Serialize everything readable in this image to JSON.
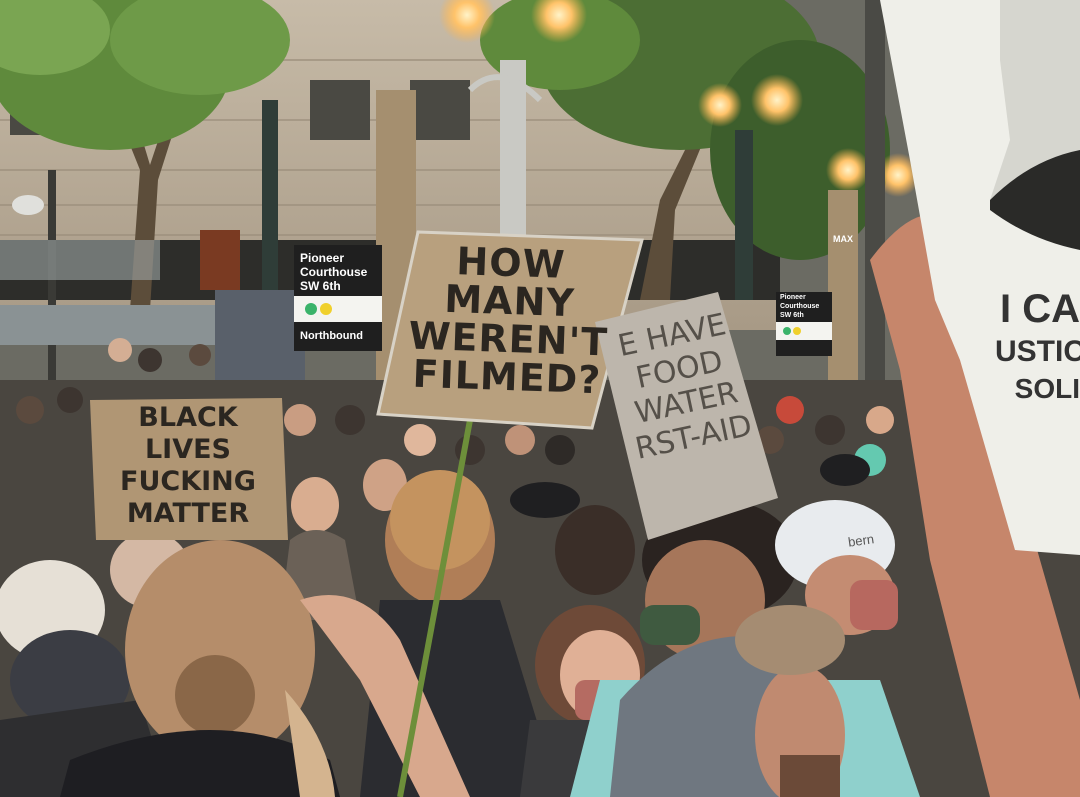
{
  "scene": {
    "description_free": true
  },
  "signs": {
    "black_lives": {
      "lines": [
        "BLACK",
        "LIVES",
        "FUCKING",
        "MATTER"
      ]
    },
    "how_many": {
      "lines": [
        "HOW MANY",
        "WEREN'T",
        "FILMED?"
      ]
    },
    "we_have": {
      "lines": [
        "E HAVE",
        "FOOD",
        "WATER",
        "RST-AID"
      ]
    },
    "poster_right": {
      "lines": [
        "I CA",
        "USTIC",
        "SOLI"
      ]
    }
  },
  "street_signs": {
    "left": {
      "line1": "Pioneer",
      "line2": "Courthouse",
      "line3": "SW 6th",
      "bottom": "Northbound"
    },
    "right": {
      "line1": "Pioneer",
      "line2": "Courthouse",
      "line3": "SW 6th"
    },
    "max": "MAX"
  },
  "helmet_text": "bern",
  "colors": {
    "cardboard": "#b49a78",
    "sky_foliage": "#6f8f4a",
    "building": "#b9ab98",
    "lamp_glow": "#ffb347"
  }
}
